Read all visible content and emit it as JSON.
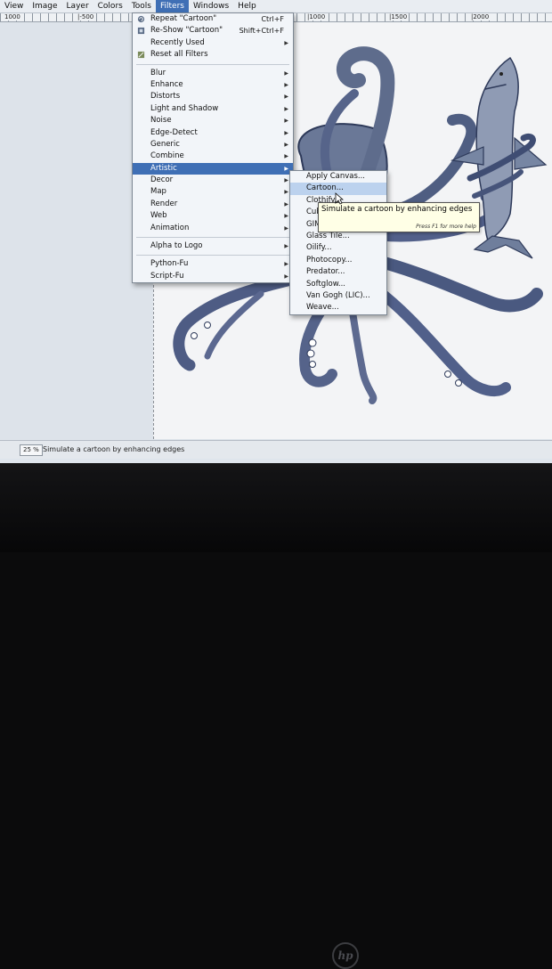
{
  "menubar": {
    "items": [
      "View",
      "Image",
      "Layer",
      "Colors",
      "Tools",
      "Filters",
      "Windows",
      "Help"
    ],
    "active": "Filters"
  },
  "ruler": {
    "labels": [
      "1000",
      "|-500",
      "|1000",
      "|1500",
      "|2000"
    ]
  },
  "filters_menu": {
    "repeat": {
      "label": "Repeat \"Cartoon\"",
      "shortcut": "Ctrl+F"
    },
    "reshow": {
      "label": "Re-Show \"Cartoon\"",
      "shortcut": "Shift+Ctrl+F"
    },
    "recently_used": "Recently Used",
    "reset_all": "Reset all Filters",
    "categories": [
      "Blur",
      "Enhance",
      "Distorts",
      "Light and Shadow",
      "Noise",
      "Edge-Detect",
      "Generic",
      "Combine",
      "Artistic",
      "Decor",
      "Map",
      "Render",
      "Web",
      "Animation"
    ],
    "alpha_to_logo": "Alpha to Logo",
    "python_fu": "Python-Fu",
    "script_fu": "Script-Fu"
  },
  "artistic_menu": {
    "items": [
      "Apply Canvas...",
      "Cartoon...",
      "Clothify...",
      "Cubism...",
      "GIMPressionist...",
      "Glass Tile...",
      "Oilify...",
      "Photocopy...",
      "Predator...",
      "Softglow...",
      "Van Gogh (LIC)...",
      "Weave..."
    ]
  },
  "tooltip": {
    "text": "Simulate a cartoon by enhancing edges",
    "hint": "Press F1 for more help"
  },
  "statusbar": {
    "zoom": "25 %",
    "text": "Simulate a cartoon by enhancing edges"
  },
  "bezel": {
    "logo": "hp"
  },
  "colors": {
    "highlight": "#3f6fb5",
    "menu_bg": "#f2f5f9",
    "tooltip_bg": "#ffffe6",
    "ink": "#2e3a5a"
  }
}
